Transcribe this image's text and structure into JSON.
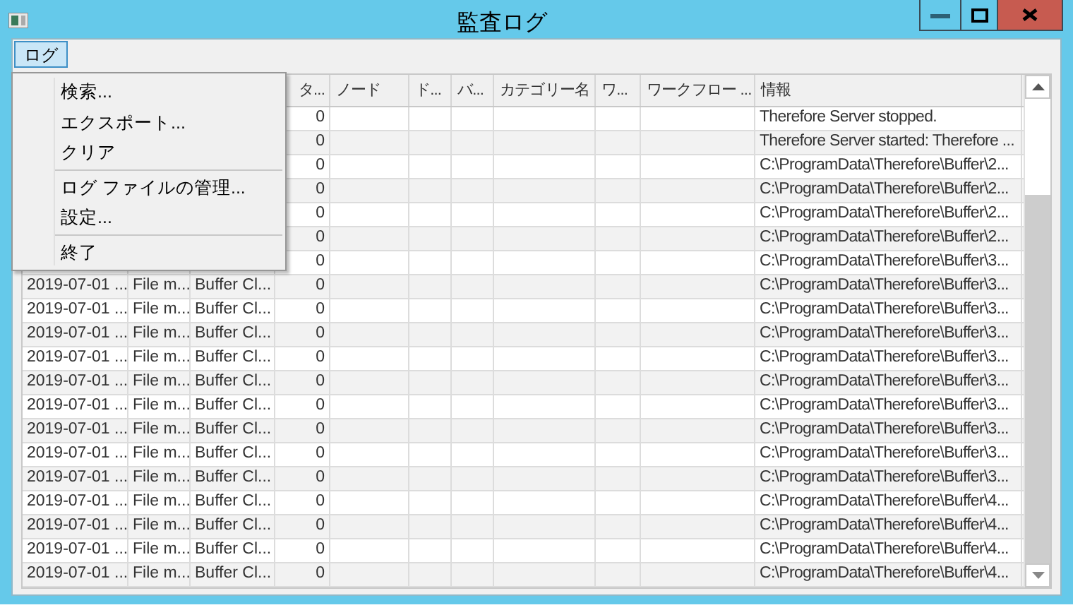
{
  "window": {
    "title": "監査ログ"
  },
  "menu_bar": [
    {
      "label": "ログ",
      "selected": true
    }
  ],
  "menu": [
    {
      "kind": "item",
      "label": "検索..."
    },
    {
      "kind": "item",
      "label": "エクスポート..."
    },
    {
      "kind": "item",
      "label": "クリア"
    },
    {
      "kind": "separator"
    },
    {
      "kind": "item",
      "label": "ログ ファイルの管理..."
    },
    {
      "kind": "item",
      "label": "設定..."
    },
    {
      "kind": "separator"
    },
    {
      "kind": "item",
      "label": "終了"
    }
  ],
  "table": {
    "columns": [
      {},
      {},
      {},
      {
        "label": "タ..."
      },
      {
        "label": "ノード"
      },
      {
        "label": "ド..."
      },
      {
        "label": "バ..."
      },
      {
        "label": "カテゴリー名"
      },
      {
        "label": "ワ..."
      },
      {
        "label": "ワークフロー ..."
      },
      {
        "label": "情報"
      }
    ],
    "rows": [
      {
        "count": "0",
        "info": "Therefore Server stopped."
      },
      {
        "count": "0",
        "info": "Therefore Server started: Therefore ..."
      },
      {
        "count": "0",
        "info": "C:\\ProgramData\\Therefore\\Buffer\\2..."
      },
      {
        "count": "0",
        "info": "C:\\ProgramData\\Therefore\\Buffer\\2..."
      },
      {
        "count": "0",
        "info": "C:\\ProgramData\\Therefore\\Buffer\\2..."
      },
      {
        "count": "0",
        "info": "C:\\ProgramData\\Therefore\\Buffer\\2..."
      },
      {
        "count": "0",
        "info": "C:\\ProgramData\\Therefore\\Buffer\\3..."
      },
      {
        "date": "2019-07-01 ...",
        "type": "File m...",
        "source": "Buffer Cl...",
        "count": "0",
        "info": "C:\\ProgramData\\Therefore\\Buffer\\3..."
      },
      {
        "date": "2019-07-01 ...",
        "type": "File m...",
        "source": "Buffer Cl...",
        "count": "0",
        "info": "C:\\ProgramData\\Therefore\\Buffer\\3..."
      },
      {
        "date": "2019-07-01 ...",
        "type": "File m...",
        "source": "Buffer Cl...",
        "count": "0",
        "info": "C:\\ProgramData\\Therefore\\Buffer\\3..."
      },
      {
        "date": "2019-07-01 ...",
        "type": "File m...",
        "source": "Buffer Cl...",
        "count": "0",
        "info": "C:\\ProgramData\\Therefore\\Buffer\\3..."
      },
      {
        "date": "2019-07-01 ...",
        "type": "File m...",
        "source": "Buffer Cl...",
        "count": "0",
        "info": "C:\\ProgramData\\Therefore\\Buffer\\3..."
      },
      {
        "date": "2019-07-01 ...",
        "type": "File m...",
        "source": "Buffer Cl...",
        "count": "0",
        "info": "C:\\ProgramData\\Therefore\\Buffer\\3..."
      },
      {
        "date": "2019-07-01 ...",
        "type": "File m...",
        "source": "Buffer Cl...",
        "count": "0",
        "info": "C:\\ProgramData\\Therefore\\Buffer\\3..."
      },
      {
        "date": "2019-07-01 ...",
        "type": "File m...",
        "source": "Buffer Cl...",
        "count": "0",
        "info": "C:\\ProgramData\\Therefore\\Buffer\\3..."
      },
      {
        "date": "2019-07-01 ...",
        "type": "File m...",
        "source": "Buffer Cl...",
        "count": "0",
        "info": "C:\\ProgramData\\Therefore\\Buffer\\3..."
      },
      {
        "date": "2019-07-01 ...",
        "type": "File m...",
        "source": "Buffer Cl...",
        "count": "0",
        "info": "C:\\ProgramData\\Therefore\\Buffer\\4..."
      },
      {
        "date": "2019-07-01 ...",
        "type": "File m...",
        "source": "Buffer Cl...",
        "count": "0",
        "info": "C:\\ProgramData\\Therefore\\Buffer\\4..."
      },
      {
        "date": "2019-07-01 ...",
        "type": "File m...",
        "source": "Buffer Cl...",
        "count": "0",
        "info": "C:\\ProgramData\\Therefore\\Buffer\\4..."
      },
      {
        "date": "2019-07-01 ...",
        "type": "File m...",
        "source": "Buffer Cl...",
        "count": "0",
        "info": "C:\\ProgramData\\Therefore\\Buffer\\4..."
      }
    ]
  }
}
